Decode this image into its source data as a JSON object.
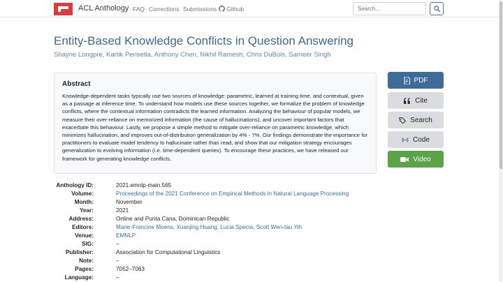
{
  "nav": {
    "brand": "ACL Anthology",
    "links": [
      "FAQ",
      "Corrections",
      "Submissions",
      "Github"
    ],
    "search_placeholder": "Search...",
    "icons": {
      "logo": "acl-logo-icon",
      "github": "github-icon",
      "search": "search-icon"
    }
  },
  "paper": {
    "title": "Entity-Based Knowledge Conflicts in Question Answering",
    "authors": [
      "Shayne Longpre",
      "Kartik Perisetla",
      "Anthony Chen",
      "Nikhil Ramesh",
      "Chris DuBois",
      "Sameer Singh"
    ],
    "abstract_heading": "Abstract",
    "abstract": "Knowledge-dependent tasks typically use two sources of knowledge: parametric, learned at training time, and contextual, given as a passage at inference time. To understand how models use these sources together, we formalize the problem of knowledge conflicts, where the contextual information contradicts the learned information. Analyzing the behaviour of popular models, we measure their over-reliance on memorized information (the cause of hallucinations), and uncover important factors that exacerbate this behaviour. Lastly, we propose a simple method to mitigate over-reliance on parametric knowledge, which minimizes hallucination, and improves out-of-distribution generalization by 4% - 7%. Our findings demonstrate the importance for practitioners to evaluate model tendency to hallucinate rather than read, and show that our mitigation strategy encourages generalization to evolving information (i.e. time-dependent queries). To encourage these practices, we have released our framework for generating knowledge conflicts."
  },
  "buttons": {
    "pdf": "PDF",
    "cite": "Cite",
    "search": "Search",
    "code": "Code",
    "video": "Video"
  },
  "metadata": [
    {
      "label": "Anthology ID:",
      "value": "2021.emnlp-main.565",
      "link": false
    },
    {
      "label": "Volume:",
      "value": "Proceedings of the 2021 Conference on Empirical Methods in Natural Language Processing",
      "link": true
    },
    {
      "label": "Month:",
      "value": "November",
      "link": false
    },
    {
      "label": "Year:",
      "value": "2021",
      "link": false
    },
    {
      "label": "Address:",
      "value": "Online and Punta Cana, Dominican Republic",
      "link": false
    },
    {
      "label": "Editors:",
      "value": "Marie-Francine Moens, Xuanjing Huang, Lucia Specia, Scott Wen-tau Yih",
      "link": true
    },
    {
      "label": "Venue:",
      "value": "EMNLP",
      "link": true
    },
    {
      "label": "SIG:",
      "value": "–",
      "link": false
    },
    {
      "label": "Publisher:",
      "value": "Association for Computational Linguistics",
      "link": false
    },
    {
      "label": "Note:",
      "value": "–",
      "link": false
    },
    {
      "label": "Pages:",
      "value": "7052–7063",
      "link": false
    },
    {
      "label": "Language:",
      "value": "–",
      "link": false
    }
  ],
  "colors": {
    "brand_red": "#e03a3a",
    "title_blue": "#40688f",
    "link_blue": "#3d6b9a",
    "video_green": "#5aa347",
    "button_gray": "#dadcdf"
  }
}
